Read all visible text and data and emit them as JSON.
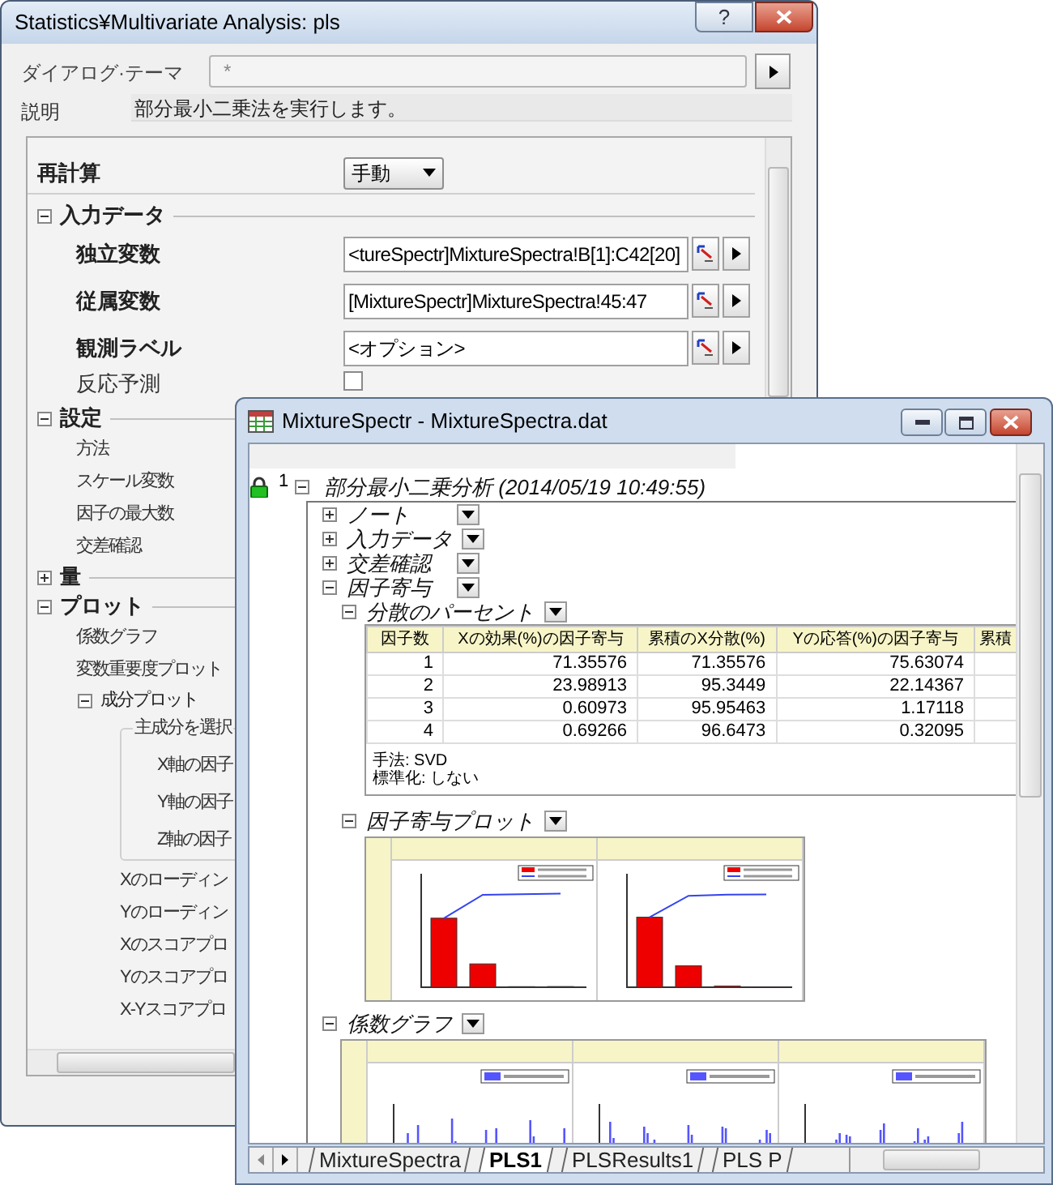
{
  "dialog": {
    "title": "Statistics¥Multivariate Analysis: pls",
    "help_button": "?",
    "theme_label": "ダイアログ·テーマ",
    "theme_value": "*",
    "description_label": "説明",
    "description": "部分最小二乗法を実行します。",
    "settings": [
      {
        "kind": "dropdown",
        "label": "再計算",
        "value": "手動"
      },
      {
        "kind": "section",
        "label": "入力データ",
        "expanded": true,
        "children": [
          {
            "kind": "range",
            "label": "独立変数",
            "value": "<tureSpectr]MixtureSpectra!B[1]:C42[20]"
          },
          {
            "kind": "range",
            "label": "従属変数",
            "value": "[MixtureSpectr]MixtureSpectra!45:47"
          },
          {
            "kind": "range",
            "label": "観測ラベル",
            "value": "<オプション>"
          },
          {
            "kind": "checkbox",
            "label": "反応予測",
            "checked": false
          }
        ]
      },
      {
        "kind": "section",
        "label": "設定",
        "expanded": true,
        "children": [
          {
            "kind": "label",
            "label": "方法"
          },
          {
            "kind": "label",
            "label": "スケール変数"
          },
          {
            "kind": "label",
            "label": "因子の最大数"
          },
          {
            "kind": "label",
            "label": "交差確認"
          }
        ]
      },
      {
        "kind": "section",
        "label": "量",
        "expanded": false
      },
      {
        "kind": "section",
        "label": "プロット",
        "expanded": true,
        "children": [
          {
            "kind": "label",
            "label": "係数グラフ"
          },
          {
            "kind": "label",
            "label": "変数重要度プロット"
          },
          {
            "kind": "section",
            "label": "成分プロット",
            "expanded": true,
            "children": [
              {
                "kind": "group",
                "label": "主成分を選択",
                "children": [
                  {
                    "kind": "label",
                    "label": "X軸の因子"
                  },
                  {
                    "kind": "label",
                    "label": "Y軸の因子"
                  },
                  {
                    "kind": "label",
                    "label": "Z軸の因子"
                  }
                ]
              },
              {
                "kind": "label",
                "label": "Xのローディン"
              },
              {
                "kind": "label",
                "label": "Yのローディン"
              },
              {
                "kind": "label",
                "label": "Xのスコアプロ"
              },
              {
                "kind": "label",
                "label": "Yのスコアプロ"
              },
              {
                "kind": "label",
                "label": "X-Yスコアプロ"
              }
            ]
          }
        ]
      }
    ]
  },
  "workbook": {
    "title": "MixtureSpectr - MixtureSpectra.dat",
    "row_number": "1",
    "report_title": "部分最小二乗分析 (2014/05/19 10:49:55)",
    "report_expanded": true,
    "nodes": [
      {
        "kind": "section",
        "label": "ノート",
        "expanded": false
      },
      {
        "kind": "section",
        "label": "入力データ",
        "expanded": false
      },
      {
        "kind": "section",
        "label": "交差確認",
        "expanded": false
      },
      {
        "kind": "section",
        "label": "因子寄与",
        "expanded": true,
        "children": [
          {
            "kind": "table",
            "label": "分散のパーセント",
            "expanded": true,
            "columns": [
              "因子数",
              "Xの効果(%)の因子寄与",
              "累積のX分散(%)",
              "Yの応答(%)の因子寄与",
              "累積"
            ],
            "rows": [
              [
                "1",
                "71.35576",
                "71.35576",
                "75.63074"
              ],
              [
                "2",
                "23.98913",
                "95.3449",
                "22.14367"
              ],
              [
                "3",
                "0.60973",
                "95.95463",
                "1.17118"
              ],
              [
                "4",
                "0.69266",
                "96.6473",
                "0.32095"
              ]
            ],
            "notes": [
              "手法: SVD",
              "標準化: しない"
            ]
          },
          {
            "kind": "factor_plots",
            "label": "因子寄与プロット",
            "expanded": true
          }
        ]
      },
      {
        "kind": "coefficient_plots",
        "label": "係数グラフ",
        "expanded": true
      }
    ],
    "sheet_tabs": [
      {
        "label": "MixtureSpectra",
        "selected": false
      },
      {
        "label": "PLS1",
        "selected": true
      },
      {
        "label": "PLSResults1",
        "selected": false
      },
      {
        "label": "PLS P",
        "selected": false
      }
    ]
  }
}
